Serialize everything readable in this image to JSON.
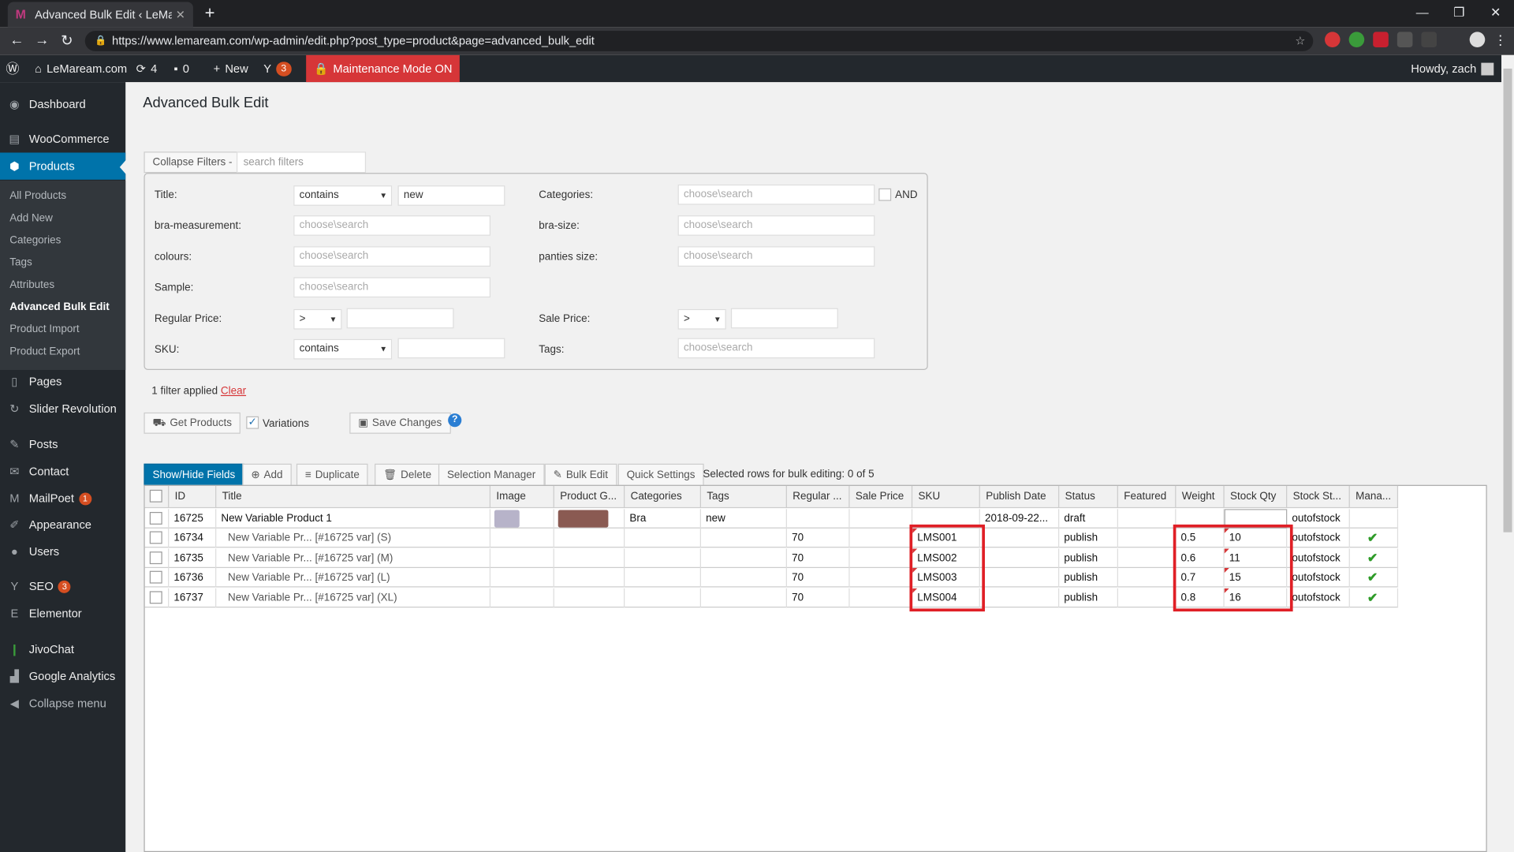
{
  "browser": {
    "tab_title": "Advanced Bulk Edit ‹ LeMaream.c",
    "url": "https://www.lemaream.com/wp-admin/edit.php?post_type=product&page=advanced_bulk_edit"
  },
  "adminbar": {
    "site": "LeMaream.com",
    "updates": "4",
    "comments": "0",
    "new": "New",
    "yoast_count": "3",
    "maintenance": "Maintenance Mode ON",
    "howdy": "Howdy, zach"
  },
  "sidebar": {
    "dashboard": "Dashboard",
    "woocommerce": "WooCommerce",
    "products": "Products",
    "sub": [
      "All Products",
      "Add New",
      "Categories",
      "Tags",
      "Attributes",
      "Advanced Bulk Edit",
      "Product Import",
      "Product Export"
    ],
    "pages": "Pages",
    "slider": "Slider Revolution",
    "posts": "Posts",
    "contact": "Contact",
    "mailpoet": "MailPoet",
    "mailpoet_count": "1",
    "appearance": "Appearance",
    "users": "Users",
    "seo": "SEO",
    "seo_count": "3",
    "elementor": "Elementor",
    "jivochat": "JivoChat",
    "ga": "Google Analytics",
    "collapse": "Collapse menu"
  },
  "page_title": "Advanced Bulk Edit",
  "filters": {
    "collapse_label": "Collapse Filters -",
    "search_placeholder": "search filters",
    "title_label": "Title:",
    "title_op": "contains",
    "title_value": "new",
    "categories_label": "Categories:",
    "categories_placeholder": "choose\\search",
    "and_label": "AND",
    "bra_measurement_label": "bra-measurement:",
    "bra_size_label": "bra-size:",
    "colours_label": "colours:",
    "panties_label": "panties size:",
    "sample_label": "Sample:",
    "regular_price_label": "Regular Price:",
    "regular_price_op": ">",
    "sale_price_label": "Sale Price:",
    "sale_price_op": ">",
    "sku_label": "SKU:",
    "sku_op": "contains",
    "tags_label": "Tags:",
    "placeholder": "choose\\search",
    "applied_text": "1 filter applied",
    "clear": "Clear"
  },
  "actions": {
    "get_products": "Get Products",
    "variations": "Variations",
    "save_changes": "Save Changes",
    "help": "?"
  },
  "grid_toolbar": {
    "show_hide": "Show/Hide Fields",
    "add": "Add",
    "duplicate": "Duplicate",
    "delete": "Delete",
    "selection_manager": "Selection Manager",
    "bulk_edit": "Bulk Edit",
    "quick_settings": "Quick Settings",
    "selected_info": "Selected rows for bulk editing:  0 of 5"
  },
  "grid": {
    "columns": [
      "ID",
      "Title",
      "Image",
      "Product G...",
      "Categories",
      "Tags",
      "Regular ...",
      "Sale Price",
      "SKU",
      "Publish Date",
      "Status",
      "Featured",
      "Weight",
      "Stock Qty",
      "Stock St...",
      "Mana..."
    ],
    "rows": [
      {
        "id": "16725",
        "title": "New Variable Product 1",
        "categories": "Bra",
        "tags": "new",
        "regular": "",
        "sku": "",
        "publish": "2018-09-22...",
        "status": "draft",
        "weight": "",
        "qty": "",
        "stock": "outofstock",
        "manage": ""
      },
      {
        "id": "16734",
        "title": "New Variable Pr... [#16725 var] (S)",
        "categories": "",
        "tags": "",
        "regular": "70",
        "sku": "LMS001",
        "publish": "",
        "status": "publish",
        "weight": "0.5",
        "qty": "10",
        "stock": "outofstock",
        "manage": "✔"
      },
      {
        "id": "16735",
        "title": "New Variable Pr... [#16725 var] (M)",
        "categories": "",
        "tags": "",
        "regular": "70",
        "sku": "LMS002",
        "publish": "",
        "status": "publish",
        "weight": "0.6",
        "qty": "11",
        "stock": "outofstock",
        "manage": "✔"
      },
      {
        "id": "16736",
        "title": "New Variable Pr... [#16725 var] (L)",
        "categories": "",
        "tags": "",
        "regular": "70",
        "sku": "LMS003",
        "publish": "",
        "status": "publish",
        "weight": "0.7",
        "qty": "15",
        "stock": "outofstock",
        "manage": "✔"
      },
      {
        "id": "16737",
        "title": "New Variable Pr... [#16725 var] (XL)",
        "categories": "",
        "tags": "",
        "regular": "70",
        "sku": "LMS004",
        "publish": "",
        "status": "publish",
        "weight": "0.8",
        "qty": "16",
        "stock": "outofstock",
        "manage": "✔"
      }
    ]
  }
}
